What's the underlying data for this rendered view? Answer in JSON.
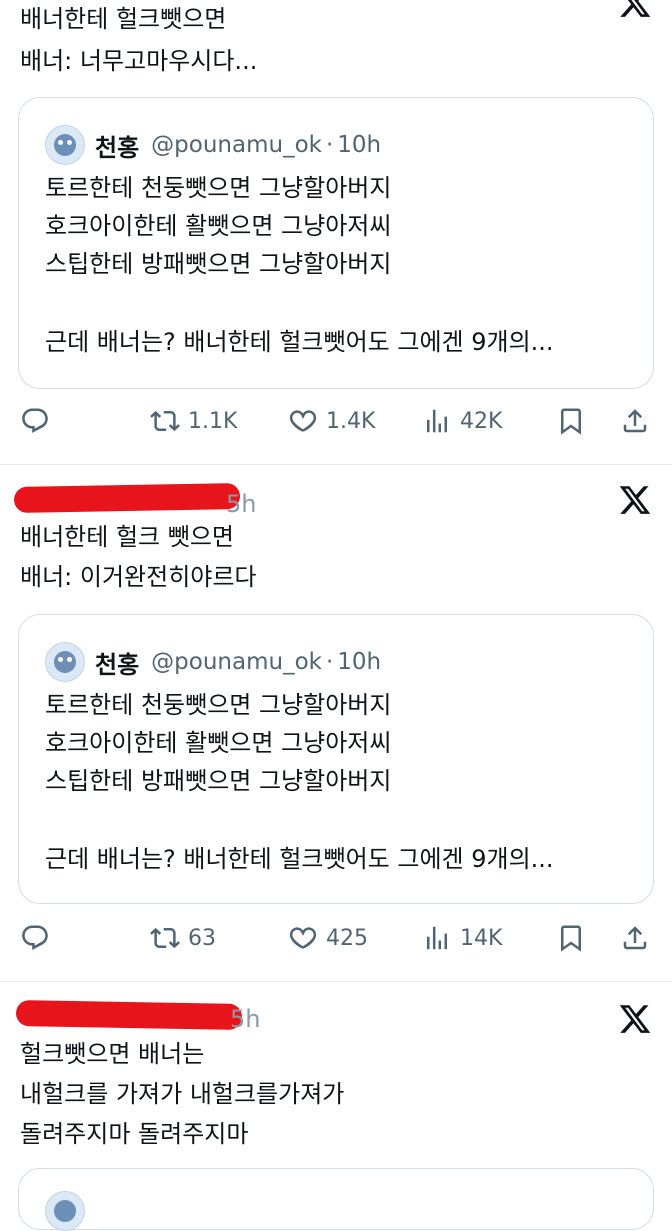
{
  "post1": {
    "lines": [
      "배너한테 헐크뺏으면",
      "배너: 너무고마우시다..."
    ],
    "quote": {
      "name": "천홍",
      "handle": "@pounamu_ok",
      "dot": "·",
      "time": "10h",
      "lines": [
        "토르한테 천둥뺏으면 그냥할아버지",
        "호크아이한테 활뺏으면 그냥아저씨",
        "스팁한테 방패뺏으면 그냥할아버지",
        "",
        "근데 배너는? 배너한테 헐크뺏어도 그에겐 9개의..."
      ]
    },
    "actions": {
      "retweets": "1.1K",
      "likes": "1.4K",
      "views": "42K"
    }
  },
  "post2": {
    "time_fragment": "5h",
    "lines": [
      "배너한테 헐크 뺏으면",
      "배너: 이거완전히야르다"
    ],
    "quote": {
      "name": "천홍",
      "handle": "@pounamu_ok",
      "dot": "·",
      "time": "10h",
      "lines": [
        "토르한테 천둥뺏으면 그냥할아버지",
        "호크아이한테 활뺏으면 그냥아저씨",
        "스팁한테 방패뺏으면 그냥할아버지",
        "",
        "근데 배너는? 배너한테 헐크뺏어도 그에겐 9개의..."
      ]
    },
    "actions": {
      "retweets": "63",
      "likes": "425",
      "views": "14K"
    }
  },
  "post3": {
    "time_fragment": "5h",
    "lines": [
      "헐크뺏으면 배너는",
      "내헐크를 가져가 내헐크를가져가",
      "돌려주지마 돌려주지마"
    ]
  },
  "icons": [
    "reply-icon",
    "retweet-icon",
    "like-icon",
    "views-icon",
    "bookmark-icon",
    "share-icon",
    "x-logo-icon"
  ],
  "colors": {
    "redaction": "#e8141c",
    "text": "#0f1419",
    "secondary": "#536471"
  }
}
